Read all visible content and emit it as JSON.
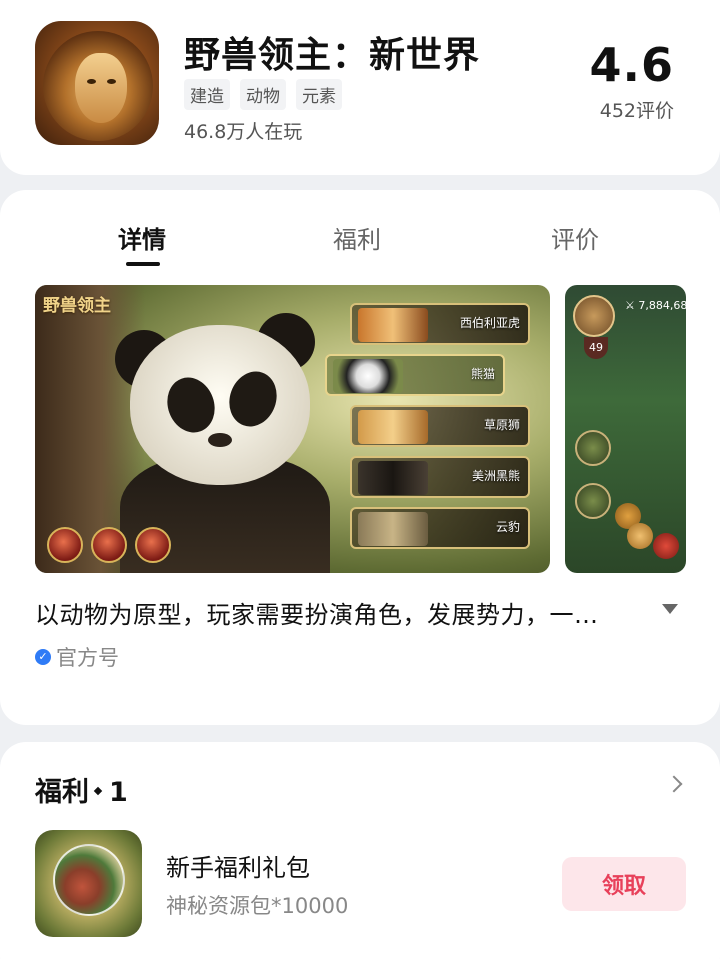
{
  "app": {
    "title": "野兽领主：新世界",
    "tags": [
      "建造",
      "动物",
      "元素"
    ],
    "players": "46.8万人在玩",
    "rating": "4.6",
    "rating_count": "452评价",
    "icon": "lion-icon"
  },
  "tabs": [
    {
      "label": "详情",
      "active": true
    },
    {
      "label": "福利",
      "active": false
    },
    {
      "label": "评价",
      "active": false
    }
  ],
  "screenshot1": {
    "logo_text": "野兽领主",
    "animals": [
      "西伯利亚虎",
      "熊猫",
      "草原狮",
      "美洲黑熊",
      "云豹"
    ],
    "selected_animal": "熊猫"
  },
  "screenshot2": {
    "level": "49",
    "stat": "⚔ 7,884,68"
  },
  "description": "以动物为原型，玩家需要扮演角色，发展势力，一…",
  "official_label": "官方号",
  "welfare": {
    "title": "福利",
    "count": "1",
    "item_name": "新手福利礼包",
    "item_desc": "神秘资源包*10000",
    "claim_label": "领取"
  },
  "colors": {
    "accent": "#e8405a",
    "accent_bg": "#fde6ea",
    "verify": "#2f7bf6"
  }
}
